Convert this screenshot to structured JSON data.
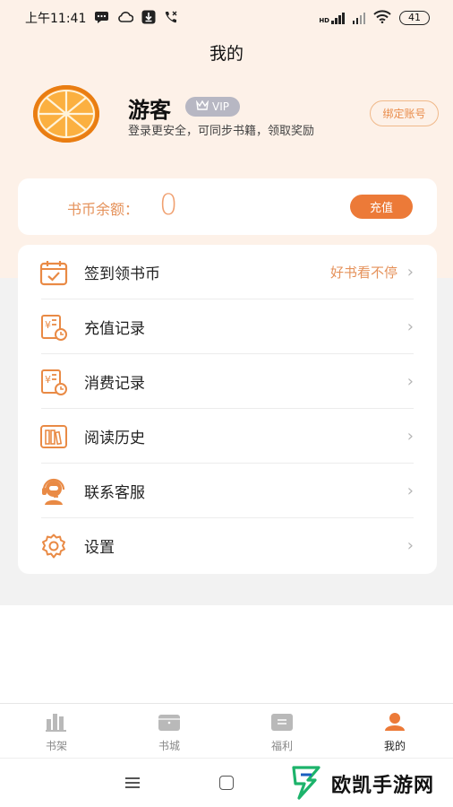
{
  "status_bar": {
    "time": "上午11:41",
    "battery": "41",
    "net_label": "HD"
  },
  "header": {
    "title": "我的"
  },
  "profile": {
    "username": "游客",
    "vip_label": "VIP",
    "subtitle": "登录更安全，可同步书籍，领取奖励",
    "bind_button": "绑定账号"
  },
  "balance": {
    "label": "书币余额：",
    "value": "0",
    "recharge_button": "充值"
  },
  "menu": {
    "items": [
      {
        "label": "签到领书币",
        "extra": "好书看不停",
        "icon": "calendar-check-icon"
      },
      {
        "label": "充值记录",
        "extra": "",
        "icon": "recharge-record-icon"
      },
      {
        "label": "消费记录",
        "extra": "",
        "icon": "consume-record-icon"
      },
      {
        "label": "阅读历史",
        "extra": "",
        "icon": "bookshelf-icon"
      },
      {
        "label": "联系客服",
        "extra": "",
        "icon": "customer-service-icon"
      },
      {
        "label": "设置",
        "extra": "",
        "icon": "gear-icon"
      }
    ]
  },
  "tabs": [
    {
      "label": "书架",
      "icon": "bookshelf-tab-icon",
      "active": false
    },
    {
      "label": "书城",
      "icon": "bookstore-tab-icon",
      "active": false
    },
    {
      "label": "福利",
      "icon": "welfare-tab-icon",
      "active": false
    },
    {
      "label": "我的",
      "icon": "profile-tab-icon",
      "active": true
    }
  ],
  "watermark": {
    "text": "欧凯手游网"
  },
  "colors": {
    "accent": "#ec7a38",
    "accent_light": "#e5925b",
    "header_bg": "#fdf1e8",
    "page_bg": "#f2f2f2"
  }
}
